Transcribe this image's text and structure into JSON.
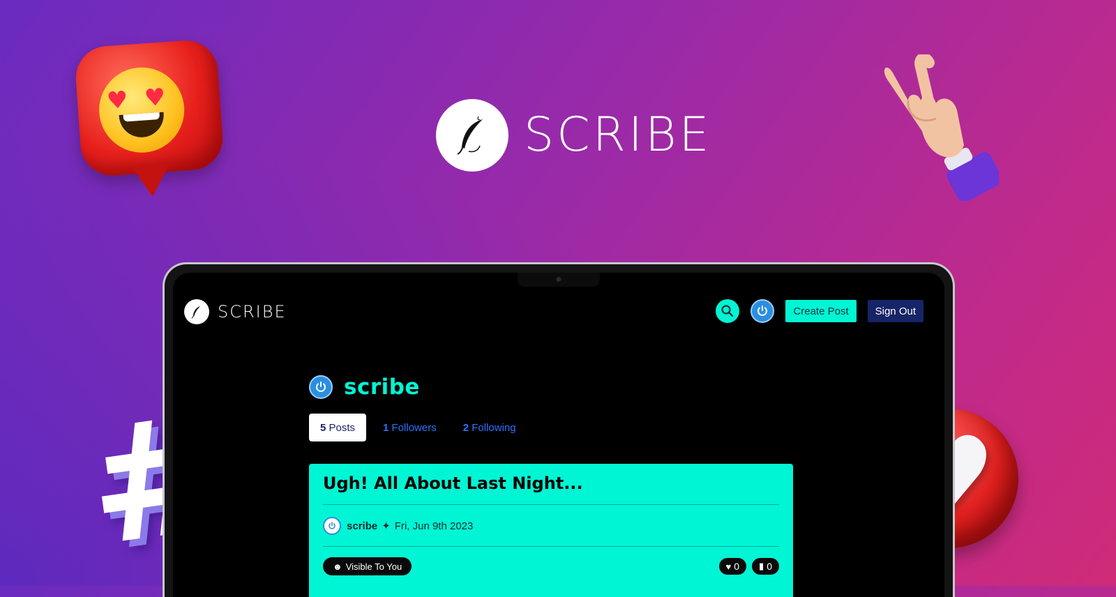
{
  "hero": {
    "brand": "SCRIBE"
  },
  "app": {
    "nav": {
      "brand": "SCRIBE",
      "create_post_label": "Create Post",
      "sign_out_label": "Sign Out"
    },
    "profile": {
      "username": "scribe",
      "tabs": [
        {
          "count": "5",
          "label": "Posts",
          "active": true
        },
        {
          "count": "1",
          "label": "Followers",
          "active": false
        },
        {
          "count": "2",
          "label": "Following",
          "active": false
        }
      ]
    },
    "post": {
      "title": "Ugh! All About Last Night...",
      "author": "scribe",
      "separator": "✦",
      "date": "Fri, Jun 9th 2023",
      "visibility": "Visible To You",
      "likes": "0",
      "bookmarks": "0"
    }
  },
  "colors": {
    "accent": "#00f5d4",
    "navy": "#162468",
    "link": "#2b73ff"
  },
  "icons": [
    "quill-icon",
    "search-icon",
    "power-icon",
    "heart-icon",
    "bookmark-icon",
    "eye-icon"
  ]
}
